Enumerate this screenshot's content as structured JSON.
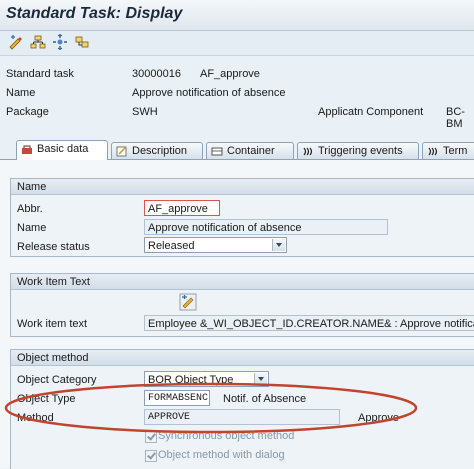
{
  "window": {
    "title": "Standard Task: Display"
  },
  "toolbar": {
    "icons": [
      "edit-display-icon",
      "object-hierarchy-icon",
      "workflow-icon",
      "where-used-icon"
    ]
  },
  "header": {
    "standard_task_label": "Standard task",
    "standard_task_id": "30000016",
    "standard_task_abbr": "AF_approve",
    "name_label": "Name",
    "name_value": "Approve notification of absence",
    "package_label": "Package",
    "package_value": "SWH",
    "app_component_label": "Applicatn Component",
    "app_component_value": "BC-BM"
  },
  "tabs": [
    {
      "label": "Basic data",
      "active": true
    },
    {
      "label": "Description",
      "active": false
    },
    {
      "label": "Container",
      "active": false
    },
    {
      "label": "Triggering events",
      "active": false
    },
    {
      "label": "Term",
      "active": false
    }
  ],
  "name_group": {
    "title": "Name",
    "abbr_label": "Abbr.",
    "abbr_value": "AF_approve",
    "name_label": "Name",
    "name_value": "Approve notification of absence",
    "release_label": "Release status",
    "release_value": "Released"
  },
  "work_item_group": {
    "title": "Work Item Text",
    "text_label": "Work item text",
    "text_value": "Employee &_WI_OBJECT_ID.CREATOR.NAME& : Approve notification"
  },
  "object_method_group": {
    "title": "Object method",
    "category_label": "Object Category",
    "category_value": "BOR Object Type",
    "type_label": "Object Type",
    "type_value": "FORMABSENC",
    "type_desc": "Notif. of Absence",
    "method_label": "Method",
    "method_value": "APPROVE",
    "method_desc": "Approve",
    "sync_label": "Synchronous object method",
    "dialog_label": "Object method with dialog"
  },
  "colors": {
    "highlight_ellipse": "#c0452c",
    "focus_border": "#d9534f"
  }
}
